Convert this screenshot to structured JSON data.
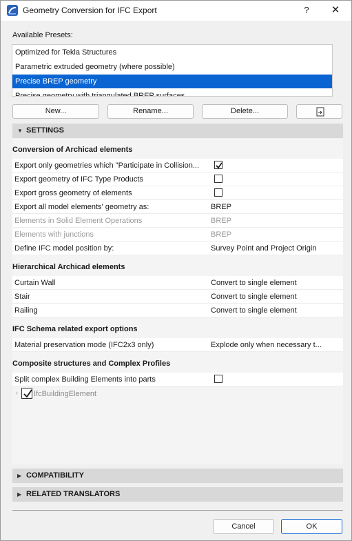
{
  "window": {
    "title": "Geometry Conversion for IFC Export",
    "help": "?",
    "close": "✕"
  },
  "presets": {
    "label": "Available Presets:",
    "items": [
      {
        "label": "Optimized for Tekla Structures",
        "selected": false
      },
      {
        "label": "Parametric extruded geometry (where possible)",
        "selected": false
      },
      {
        "label": "Precise BREP geometry",
        "selected": true
      },
      {
        "label": "Precise geometry with triangulated BREP surfaces",
        "selected": false
      }
    ]
  },
  "buttons": {
    "new": "New...",
    "rename": "Rename...",
    "delete": "Delete...",
    "export_icon": "export-preset-icon"
  },
  "sections": {
    "settings": "SETTINGS",
    "compatibility": "COMPATIBILITY",
    "related": "RELATED TRANSLATORS"
  },
  "groups": {
    "conversion": {
      "title": "Conversion of Archicad elements",
      "rows": [
        {
          "name": "Export only geometries which \"Participate in Collision...",
          "value": "",
          "checkbox": true,
          "checked": true,
          "disabled": false
        },
        {
          "name": "Export geometry of IFC Type Products",
          "value": "",
          "checkbox": true,
          "checked": false,
          "disabled": false
        },
        {
          "name": "Export gross geometry of elements",
          "value": "",
          "checkbox": true,
          "checked": false,
          "disabled": false
        },
        {
          "name": "Export all model elements' geometry as:",
          "value": "BREP",
          "checkbox": false,
          "disabled": false
        },
        {
          "name": "Elements in Solid Element Operations",
          "value": "BREP",
          "checkbox": false,
          "disabled": true
        },
        {
          "name": "Elements with junctions",
          "value": "BREP",
          "checkbox": false,
          "disabled": true
        },
        {
          "name": "Define IFC model position by:",
          "value": "Survey Point and Project Origin",
          "checkbox": false,
          "disabled": false
        }
      ]
    },
    "hierarchical": {
      "title": "Hierarchical Archicad elements",
      "rows": [
        {
          "name": "Curtain Wall",
          "value": "Convert to single element"
        },
        {
          "name": "Stair",
          "value": "Convert to single element"
        },
        {
          "name": "Railing",
          "value": "Convert to single element"
        }
      ]
    },
    "schema": {
      "title": "IFC Schema related export options",
      "rows": [
        {
          "name": "Material preservation mode (IFC2x3 only)",
          "value": "Explode only when necessary t..."
        }
      ]
    },
    "composite": {
      "title": "Composite structures and Complex Profiles",
      "rows": [
        {
          "name": "Split complex Building Elements into parts",
          "checkbox": true,
          "checked": false
        }
      ],
      "tree_item": {
        "label": "IfcBuildingElement",
        "checked": true
      }
    }
  },
  "footer": {
    "cancel": "Cancel",
    "ok": "OK"
  },
  "colors": {
    "selection": "#0a64d2",
    "section_header": "#d8d8d8",
    "disabled_text": "#9a9a9a"
  }
}
